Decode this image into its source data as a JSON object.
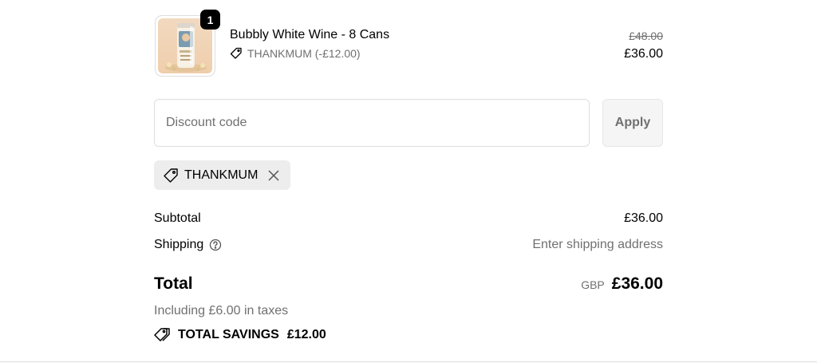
{
  "cart": {
    "item": {
      "quantity": "1",
      "name": "Bubbly White Wine - 8 Cans",
      "discount_label": "THANKMUM (-£12.00)",
      "original_price": "£48.00",
      "price": "£36.00",
      "image_icon": "wine-can-product-image"
    }
  },
  "discount": {
    "placeholder": "Discount code",
    "value": "",
    "apply_label": "Apply",
    "applied_code": "THANKMUM"
  },
  "summary": {
    "subtotal_label": "Subtotal",
    "subtotal_value": "£36.00",
    "shipping_label": "Shipping",
    "shipping_value": "Enter shipping address",
    "total_label": "Total",
    "currency": "GBP",
    "total_value": "£36.00",
    "taxes_note": "Including £6.00 in taxes",
    "savings_label": "TOTAL SAVINGS",
    "savings_value": "£12.00"
  },
  "colors": {
    "text": "#000000",
    "muted": "#707070",
    "border": "#dedede",
    "chip_bg": "#ededed",
    "button_bg": "#f5f5f5"
  }
}
